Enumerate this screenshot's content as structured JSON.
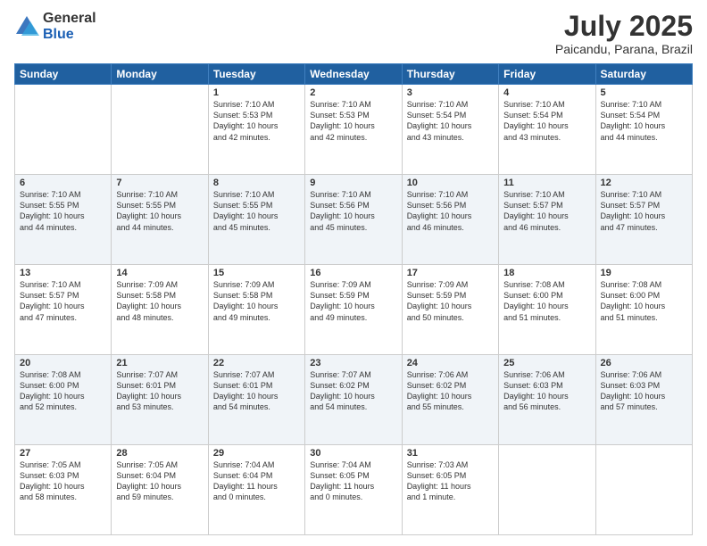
{
  "logo": {
    "general": "General",
    "blue": "Blue"
  },
  "header": {
    "month": "July 2025",
    "location": "Paicandu, Parana, Brazil"
  },
  "weekdays": [
    "Sunday",
    "Monday",
    "Tuesday",
    "Wednesday",
    "Thursday",
    "Friday",
    "Saturday"
  ],
  "weeks": [
    [
      {
        "day": "",
        "text": ""
      },
      {
        "day": "",
        "text": ""
      },
      {
        "day": "1",
        "text": "Sunrise: 7:10 AM\nSunset: 5:53 PM\nDaylight: 10 hours\nand 42 minutes."
      },
      {
        "day": "2",
        "text": "Sunrise: 7:10 AM\nSunset: 5:53 PM\nDaylight: 10 hours\nand 42 minutes."
      },
      {
        "day": "3",
        "text": "Sunrise: 7:10 AM\nSunset: 5:54 PM\nDaylight: 10 hours\nand 43 minutes."
      },
      {
        "day": "4",
        "text": "Sunrise: 7:10 AM\nSunset: 5:54 PM\nDaylight: 10 hours\nand 43 minutes."
      },
      {
        "day": "5",
        "text": "Sunrise: 7:10 AM\nSunset: 5:54 PM\nDaylight: 10 hours\nand 44 minutes."
      }
    ],
    [
      {
        "day": "6",
        "text": "Sunrise: 7:10 AM\nSunset: 5:55 PM\nDaylight: 10 hours\nand 44 minutes."
      },
      {
        "day": "7",
        "text": "Sunrise: 7:10 AM\nSunset: 5:55 PM\nDaylight: 10 hours\nand 44 minutes."
      },
      {
        "day": "8",
        "text": "Sunrise: 7:10 AM\nSunset: 5:55 PM\nDaylight: 10 hours\nand 45 minutes."
      },
      {
        "day": "9",
        "text": "Sunrise: 7:10 AM\nSunset: 5:56 PM\nDaylight: 10 hours\nand 45 minutes."
      },
      {
        "day": "10",
        "text": "Sunrise: 7:10 AM\nSunset: 5:56 PM\nDaylight: 10 hours\nand 46 minutes."
      },
      {
        "day": "11",
        "text": "Sunrise: 7:10 AM\nSunset: 5:57 PM\nDaylight: 10 hours\nand 46 minutes."
      },
      {
        "day": "12",
        "text": "Sunrise: 7:10 AM\nSunset: 5:57 PM\nDaylight: 10 hours\nand 47 minutes."
      }
    ],
    [
      {
        "day": "13",
        "text": "Sunrise: 7:10 AM\nSunset: 5:57 PM\nDaylight: 10 hours\nand 47 minutes."
      },
      {
        "day": "14",
        "text": "Sunrise: 7:09 AM\nSunset: 5:58 PM\nDaylight: 10 hours\nand 48 minutes."
      },
      {
        "day": "15",
        "text": "Sunrise: 7:09 AM\nSunset: 5:58 PM\nDaylight: 10 hours\nand 49 minutes."
      },
      {
        "day": "16",
        "text": "Sunrise: 7:09 AM\nSunset: 5:59 PM\nDaylight: 10 hours\nand 49 minutes."
      },
      {
        "day": "17",
        "text": "Sunrise: 7:09 AM\nSunset: 5:59 PM\nDaylight: 10 hours\nand 50 minutes."
      },
      {
        "day": "18",
        "text": "Sunrise: 7:08 AM\nSunset: 6:00 PM\nDaylight: 10 hours\nand 51 minutes."
      },
      {
        "day": "19",
        "text": "Sunrise: 7:08 AM\nSunset: 6:00 PM\nDaylight: 10 hours\nand 51 minutes."
      }
    ],
    [
      {
        "day": "20",
        "text": "Sunrise: 7:08 AM\nSunset: 6:00 PM\nDaylight: 10 hours\nand 52 minutes."
      },
      {
        "day": "21",
        "text": "Sunrise: 7:07 AM\nSunset: 6:01 PM\nDaylight: 10 hours\nand 53 minutes."
      },
      {
        "day": "22",
        "text": "Sunrise: 7:07 AM\nSunset: 6:01 PM\nDaylight: 10 hours\nand 54 minutes."
      },
      {
        "day": "23",
        "text": "Sunrise: 7:07 AM\nSunset: 6:02 PM\nDaylight: 10 hours\nand 54 minutes."
      },
      {
        "day": "24",
        "text": "Sunrise: 7:06 AM\nSunset: 6:02 PM\nDaylight: 10 hours\nand 55 minutes."
      },
      {
        "day": "25",
        "text": "Sunrise: 7:06 AM\nSunset: 6:03 PM\nDaylight: 10 hours\nand 56 minutes."
      },
      {
        "day": "26",
        "text": "Sunrise: 7:06 AM\nSunset: 6:03 PM\nDaylight: 10 hours\nand 57 minutes."
      }
    ],
    [
      {
        "day": "27",
        "text": "Sunrise: 7:05 AM\nSunset: 6:03 PM\nDaylight: 10 hours\nand 58 minutes."
      },
      {
        "day": "28",
        "text": "Sunrise: 7:05 AM\nSunset: 6:04 PM\nDaylight: 10 hours\nand 59 minutes."
      },
      {
        "day": "29",
        "text": "Sunrise: 7:04 AM\nSunset: 6:04 PM\nDaylight: 11 hours\nand 0 minutes."
      },
      {
        "day": "30",
        "text": "Sunrise: 7:04 AM\nSunset: 6:05 PM\nDaylight: 11 hours\nand 0 minutes."
      },
      {
        "day": "31",
        "text": "Sunrise: 7:03 AM\nSunset: 6:05 PM\nDaylight: 11 hours\nand 1 minute."
      },
      {
        "day": "",
        "text": ""
      },
      {
        "day": "",
        "text": ""
      }
    ]
  ]
}
